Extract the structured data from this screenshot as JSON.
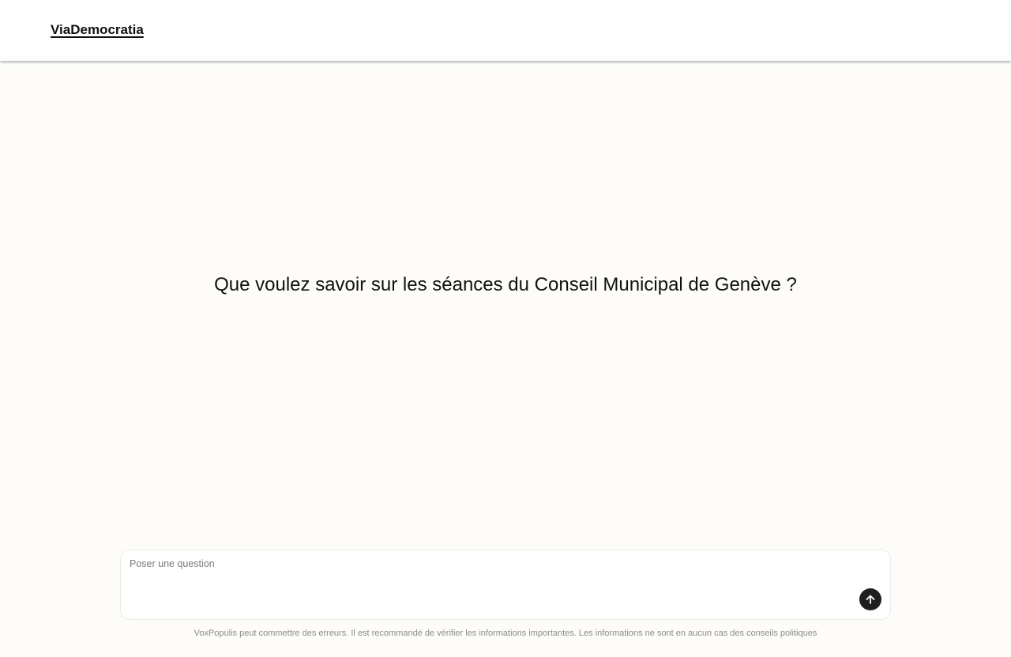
{
  "header": {
    "logo_text": "ViaDemocratia"
  },
  "main": {
    "heading": "Que voulez savoir sur les séances du Conseil Municipal de Genève ?"
  },
  "composer": {
    "placeholder": "Poser une question",
    "value": "",
    "send_icon": "arrow-up-icon"
  },
  "footer": {
    "disclaimer": "VoxPopulis peut commettre des erreurs. Il est recommandé de vérifier les informations importantes. Les informations ne sont en aucun cas des conseils politiques"
  },
  "colors": {
    "page_background": "#fdfcf8",
    "header_background": "#ffffff",
    "send_button": "#1f1f1f"
  }
}
